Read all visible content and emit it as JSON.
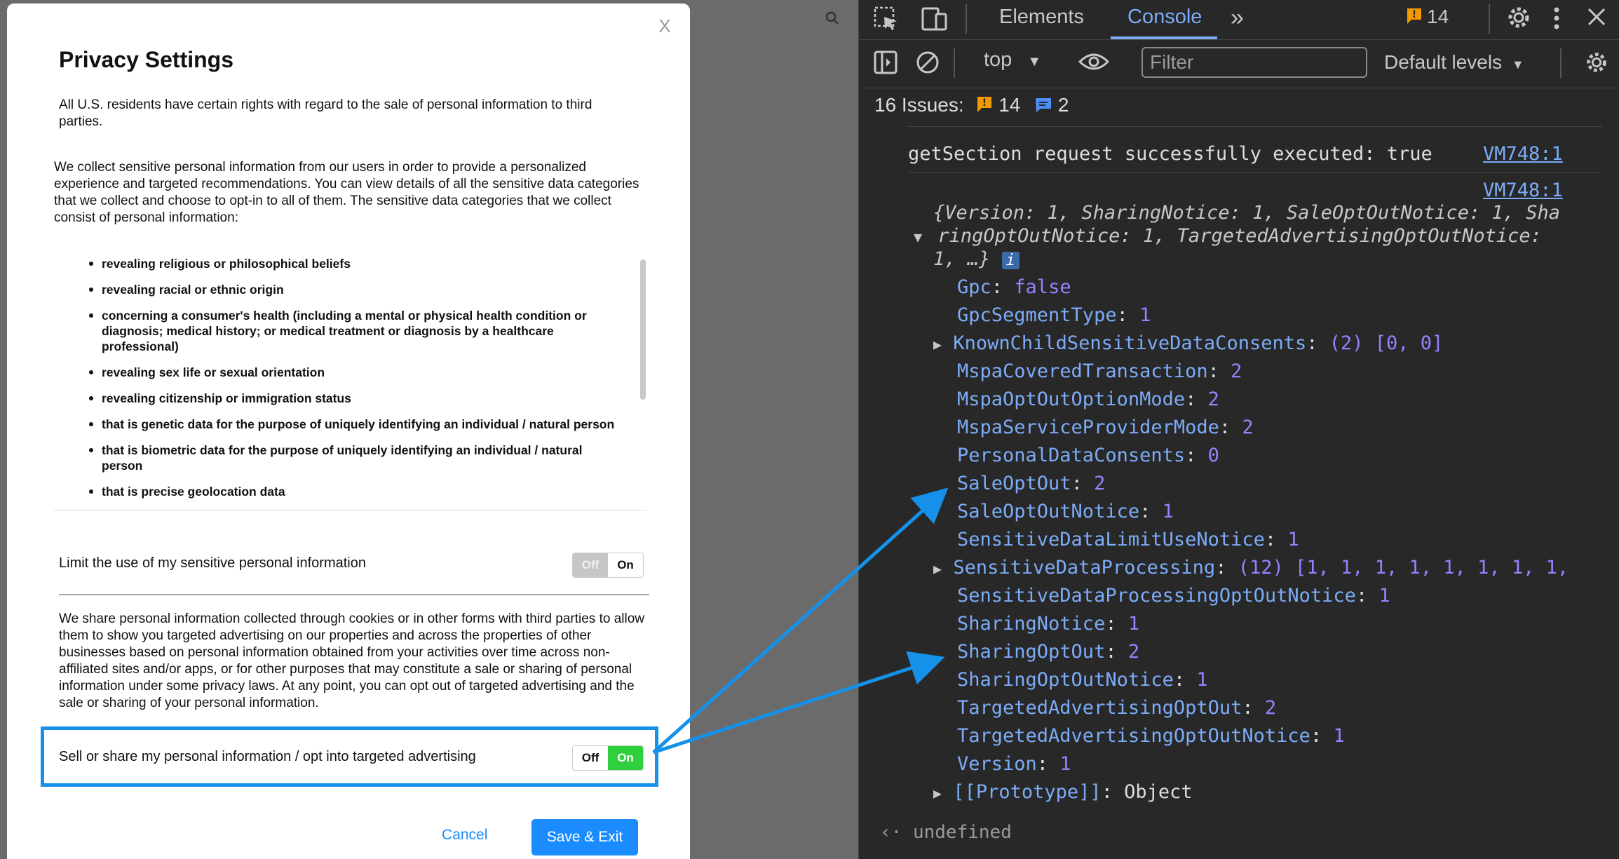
{
  "modal": {
    "close_label": "X",
    "title": "Privacy Settings",
    "intro": "All U.S. residents have certain rights with regard to the sale of personal information to third parties.",
    "collect_text": "We collect sensitive personal information from our users in order to provide a personalized experience and targeted recommendations. You can view details of all the sensitive data categories that we collect and choose to opt-in to all of them. The sensitive data categories that we collect consist of personal information:",
    "categories": [
      "revealing religious or philosophical beliefs",
      "revealing racial or ethnic origin",
      "concerning a consumer's health (including a mental or physical health condition or diagnosis; medical history; or medical treatment or diagnosis by a healthcare professional)",
      "revealing sex life or sexual orientation",
      "revealing citizenship or immigration status",
      "that is genetic data for the purpose of uniquely identifying an individual / natural person",
      "that is biometric data for the purpose of uniquely identifying an individual / natural person",
      "that is precise geolocation data"
    ],
    "limit_label": "Limit the use of my sensitive personal information",
    "share_text": "We share personal information collected through cookies or in other forms with third parties to allow them to show you targeted advertising on our properties and across the properties of other businesses based on personal information obtained from your activities over time across non-affiliated sites and/or apps, or for other purposes that may constitute a sale or sharing of personal information under some privacy laws. At any point, you can opt out of targeted advertising and the sale or sharing of your personal information.",
    "sell_label": "Sell or share my personal information / opt into targeted advertising",
    "toggle_off": "Off",
    "toggle_on": "On",
    "limit_state": "off",
    "sell_state": "on",
    "cancel_label": "Cancel",
    "save_label": "Save & Exit"
  },
  "devtools": {
    "tabs": {
      "elements": "Elements",
      "console": "Console"
    },
    "warning_count": "14",
    "context": "top",
    "filter_placeholder": "Filter",
    "levels": "Default levels",
    "issues_label": "16 Issues:",
    "issues_warnings": "14",
    "issues_info": "2",
    "log_line": "getSection request successfully executed: true",
    "source_link": "VM748:1",
    "summary_1": "{Version: 1, SharingNotice: 1, SaleOptOutNotice: 1, Sha",
    "summary_2": "ringOptOutNotice: 1, TargetedAdvertisingOptOutNotice:",
    "summary_3": "1, …}",
    "info_badge": "i",
    "props": [
      {
        "key": "Gpc",
        "value": "false"
      },
      {
        "key": "GpcSegmentType",
        "value": "1"
      },
      {
        "key": "KnownChildSensitiveDataConsents",
        "value": "(2) [0, 0]",
        "expandable": true
      },
      {
        "key": "MspaCoveredTransaction",
        "value": "2"
      },
      {
        "key": "MspaOptOutOptionMode",
        "value": "2"
      },
      {
        "key": "MspaServiceProviderMode",
        "value": "2"
      },
      {
        "key": "PersonalDataConsents",
        "value": "0"
      },
      {
        "key": "SaleOptOut",
        "value": "2"
      },
      {
        "key": "SaleOptOutNotice",
        "value": "1"
      },
      {
        "key": "SensitiveDataLimitUseNotice",
        "value": "1"
      },
      {
        "key": "SensitiveDataProcessing",
        "value": "(12) [1, 1, 1, 1, 1, 1, 1, 1,",
        "expandable": true
      },
      {
        "key": "SensitiveDataProcessingOptOutNotice",
        "value": "1"
      },
      {
        "key": "SharingNotice",
        "value": "1"
      },
      {
        "key": "SharingOptOut",
        "value": "2"
      },
      {
        "key": "SharingOptOutNotice",
        "value": "1"
      },
      {
        "key": "TargetedAdvertisingOptOut",
        "value": "2"
      },
      {
        "key": "TargetedAdvertisingOptOutNotice",
        "value": "1"
      },
      {
        "key": "Version",
        "value": "1"
      },
      {
        "key": "[[Prototype]]",
        "value": "Object",
        "expandable": true
      }
    ],
    "result": "undefined"
  },
  "colors": {
    "highlight": "#1591ea",
    "toggle_on": "#2fcf3d",
    "primary": "#1a8cff"
  }
}
